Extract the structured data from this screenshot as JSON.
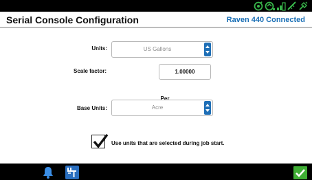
{
  "header": {
    "title": "Serial Console Configuration",
    "connection_status": "Raven 440 Connected"
  },
  "status_bar": {
    "icons": [
      "gps-status-icon",
      "signal-icon",
      "bar-graph-icon",
      "ruler-icon",
      "tool-icon"
    ],
    "icon_color": "#38b54a"
  },
  "form": {
    "units": {
      "label": "Units:",
      "value": "US Gallons"
    },
    "scale_factor": {
      "label": "Scale factor:",
      "value": "1.00000"
    },
    "per_label": "Per",
    "base_units": {
      "label": "Base Units:",
      "value": "Acre"
    },
    "use_job_units": {
      "label": "Use units that are selected during job start.",
      "checked": true
    }
  },
  "toolbar": {
    "icons": [
      "bell-icon",
      "units-icon",
      "check-icon"
    ]
  },
  "colors": {
    "accent_blue": "#1f6fb6",
    "connected_text": "#1a6fb5",
    "accept_green": "#3fae34",
    "status_green": "#38b54a"
  }
}
